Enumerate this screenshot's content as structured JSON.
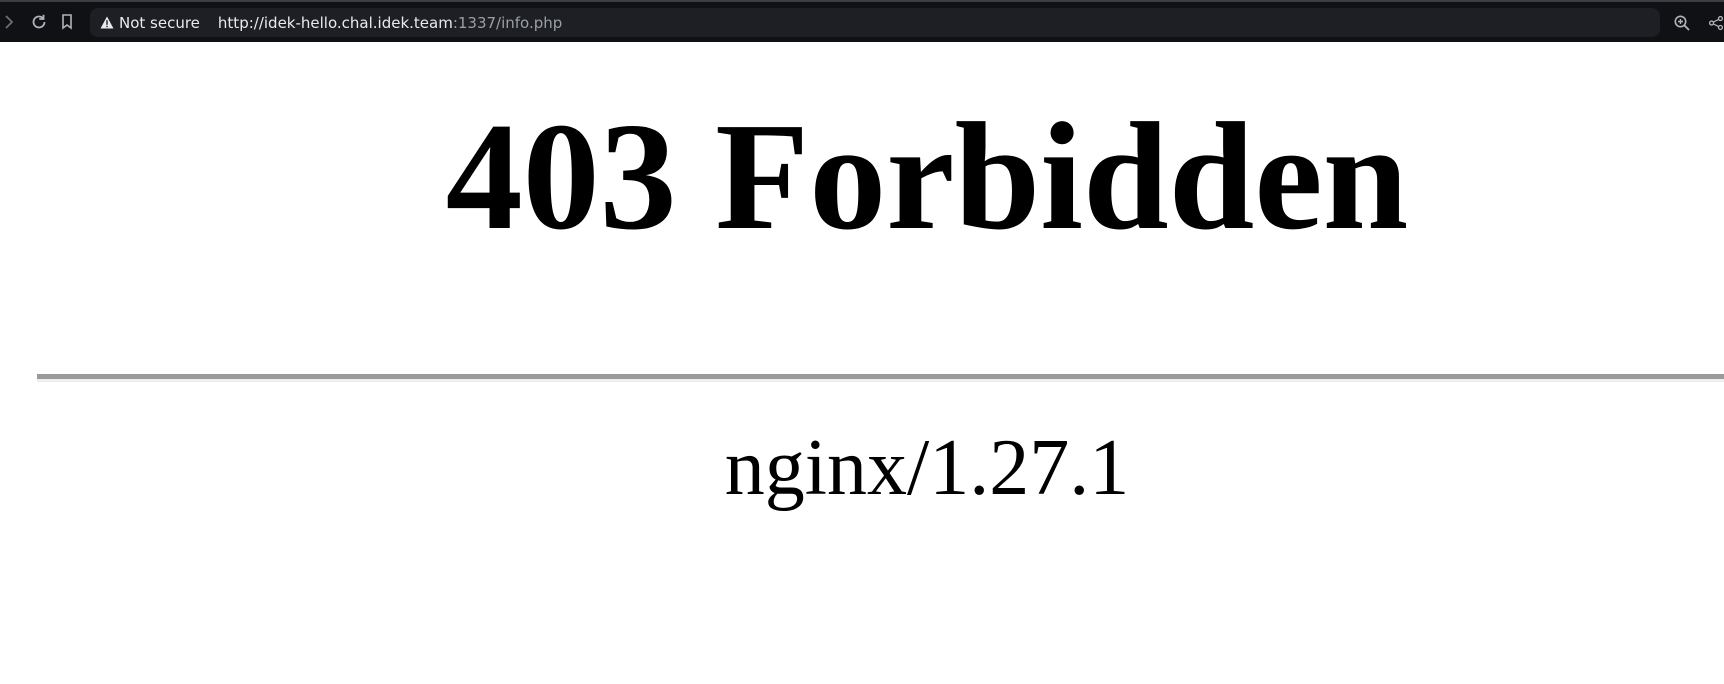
{
  "browser": {
    "security_label": "Not secure",
    "url_host": "http://idek-hello.chal.idek.team",
    "url_rest": ":1337/info.php",
    "icons": {
      "forward": "chevron-right-icon",
      "reload": "reload-icon",
      "bookmark": "bookmark-icon",
      "warning": "warning-triangle-icon",
      "zoom": "zoom-in-icon",
      "share": "share-icon"
    }
  },
  "page": {
    "heading": "403 Forbidden",
    "server": "nginx/1.27.1"
  }
}
